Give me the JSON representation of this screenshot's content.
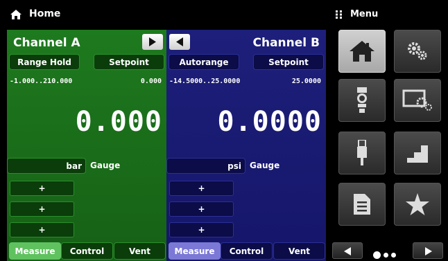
{
  "header": {
    "title": "Home",
    "menu_label": "Menu"
  },
  "channel_a": {
    "title": "Channel A",
    "range_hold": "Range Hold",
    "setpoint": "Setpoint",
    "range": "-1.000..210.000",
    "setpoint_value": "0.000",
    "reading": "0.000",
    "unit": "bar",
    "mode": "Gauge",
    "plus_buttons": [
      "+",
      "+",
      "+"
    ],
    "tabs": [
      "Measure",
      "Control",
      "Vent"
    ],
    "active_tab": "Measure",
    "color": "#1e7a1e"
  },
  "channel_b": {
    "title": "Channel B",
    "autorange": "Autorange",
    "setpoint": "Setpoint",
    "range": "-14.5000..25.0000",
    "setpoint_value": "25.0000",
    "reading": "0.0000",
    "unit": "psi",
    "mode": "Gauge",
    "plus_buttons": [
      "+",
      "+",
      "+"
    ],
    "tabs": [
      "Measure",
      "Control",
      "Vent"
    ],
    "active_tab": "Measure",
    "color": "#1d1f7a"
  },
  "menu": {
    "tiles": [
      "home-icon",
      "settings-gears-icon",
      "sensor-icon",
      "display-settings-icon",
      "usb-icon",
      "steps-icon",
      "document-icon",
      "star-icon"
    ],
    "selected": "home-icon",
    "pager": {
      "pages": 3,
      "current": 1
    }
  }
}
